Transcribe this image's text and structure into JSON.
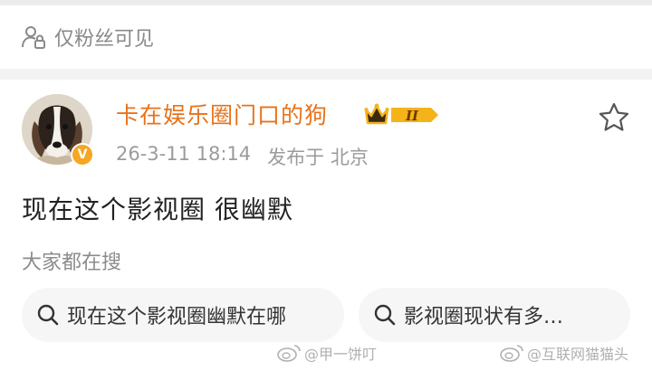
{
  "privacy": {
    "label": "仅粉丝可见",
    "icon": "lock-people-icon"
  },
  "post": {
    "author": {
      "name": "卡在娱乐圈门口的狗",
      "verified_badge_icon": "v-badge-icon",
      "vip_level": "II",
      "name_color": "#e8721c",
      "vip_gold": "#f5b31a"
    },
    "time": "26-3-11 18:14",
    "location": "发布于 北京",
    "text": "现在这个影视圈 很幽默",
    "favorite_icon": "star-icon"
  },
  "search": {
    "label": "大家都在搜",
    "chips": [
      {
        "text": "现在这个影视圈幽默在哪",
        "icon": "search-icon"
      },
      {
        "text": "影视圈现状有多…",
        "icon": "search-icon"
      }
    ]
  },
  "watermarks": [
    {
      "text": "@甲一饼叮",
      "icon": "weibo-logo-icon"
    },
    {
      "text": "@互联网猫猫头",
      "icon": "weibo-logo-icon"
    }
  ]
}
